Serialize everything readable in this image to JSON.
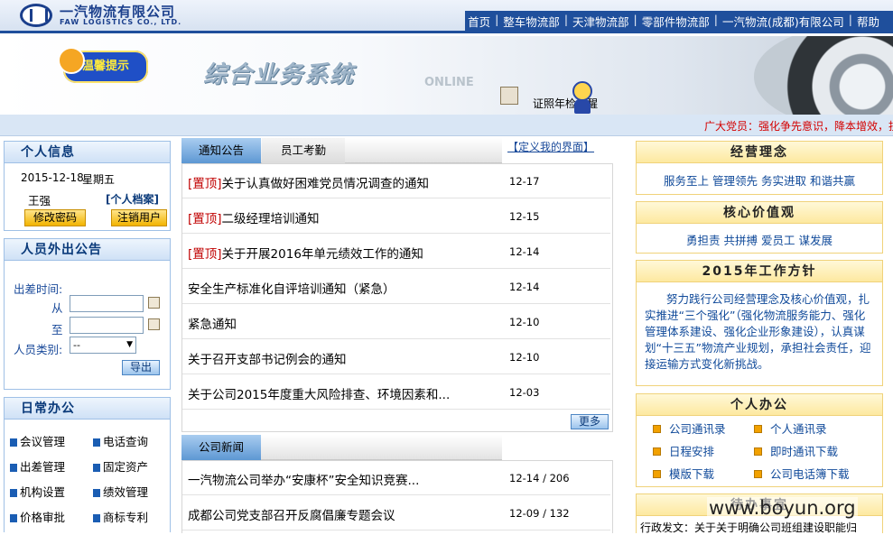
{
  "header": {
    "logo_cn": "一汽物流有限公司",
    "logo_en": "FAW LOGISTICS CO., LTD.",
    "nav": [
      "首页",
      "整车物流部",
      "天津物流部",
      "零部件物流部",
      "一汽物流(成都)有限公司",
      "帮助"
    ]
  },
  "banner": {
    "badge": "温馨提示",
    "system_title": "综合业务系统",
    "online": "ONLINE",
    "cert_reminder": "证照年检提醒"
  },
  "marquee": "广大党员：强化争先意识，降本增效，担",
  "personal": {
    "title": "个人信息",
    "date": "2015-12-18",
    "weekday": "星期五",
    "name": "王强",
    "profile_link": "[个人档案]",
    "change_pwd": "修改密码",
    "logout": "注销用户"
  },
  "outing": {
    "title": "人员外出公告",
    "trip_time_label": "出差时间:",
    "from_label": "从",
    "to_label": "至",
    "type_label": "人员类别:",
    "type_value": "--",
    "export": "导出"
  },
  "daily": {
    "title": "日常办公",
    "items": [
      "会议管理",
      "电话查询",
      "出差管理",
      "固定资产",
      "机构设置",
      "绩效管理",
      "价格审批",
      "商标专利"
    ]
  },
  "notices": {
    "tabs": [
      "通知公告",
      "员工考勤"
    ],
    "custom_link": "【定义我的界面】",
    "rows": [
      {
        "tag": "[置顶]",
        "title": "关于认真做好困难党员情况调查的通知",
        "date": "12-17"
      },
      {
        "tag": "[置顶]",
        "title": "二级经理培训通知",
        "date": "12-15"
      },
      {
        "tag": "[置顶]",
        "title": "关于开展2016年单元绩效工作的通知",
        "date": "12-14"
      },
      {
        "tag": "",
        "title": "安全生产标准化自评培训通知（紧急）",
        "date": "12-14"
      },
      {
        "tag": "",
        "title": "紧急通知",
        "date": "12-10"
      },
      {
        "tag": "",
        "title": "关于召开支部书记例会的通知",
        "date": "12-10"
      },
      {
        "tag": "",
        "title": "关于公司2015年度重大风险排查、环境因素和...",
        "date": "12-03"
      }
    ],
    "more": "更多"
  },
  "company_news": {
    "tab": "公司新闻",
    "rows": [
      {
        "title": "一汽物流公司举办“安康杯”安全知识竞赛...",
        "date": "12-14 / 206"
      },
      {
        "title": "成都公司党支部召开反腐倡廉专题会议",
        "date": "12-09 / 132"
      }
    ]
  },
  "philosophy": {
    "title": "经营理念",
    "text": "服务至上  管理领先  务实进取  和谐共赢"
  },
  "core_values": {
    "title": "核心价值观",
    "text": "勇担责  共拼搏  爱员工  谋发展"
  },
  "policy": {
    "title": "2015年工作方针",
    "text": "努力践行公司经营理念及核心价值观，扎实推进“三个强化”（强化物流服务能力、强化管理体系建设、强化企业形象建设），认真谋划“十三五”物流产业规划，承担社会责任，迎接运输方式变化新挑战。"
  },
  "personal_office": {
    "title": "个人办公",
    "items": [
      "公司通讯录",
      "个人通讯录",
      "日程安排",
      "即时通讯下载",
      "模版下载",
      "公司电话簿下载"
    ]
  },
  "todo": {
    "title": "待办事宜",
    "preview": "行政发文：关于关于明确公司班组建设职能归"
  },
  "watermark": "www.boyun.org"
}
